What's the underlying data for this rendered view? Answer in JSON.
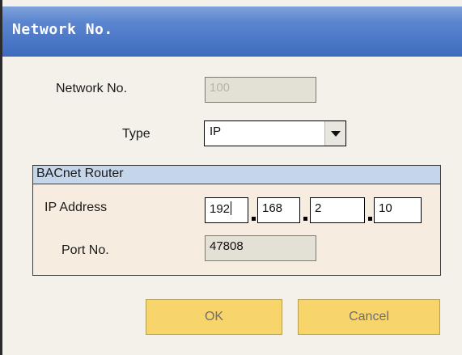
{
  "window": {
    "title": "Network No."
  },
  "form": {
    "network_no_label": "Network No.",
    "network_no_value": "100",
    "type_label": "Type",
    "type_value": "IP"
  },
  "router_group": {
    "title": "BACnet Router",
    "ip_label": "IP Address",
    "ip_octets": [
      "192",
      "168",
      "2",
      "10"
    ],
    "port_label": "Port No.",
    "port_value": "47808"
  },
  "buttons": {
    "ok_label": "OK",
    "cancel_label": "Cancel"
  },
  "colors": {
    "title_bar": "#4a76c6",
    "group_header": "#c6d6ea",
    "group_body": "#f6ede0",
    "button": "#f7d56a"
  },
  "icons": {
    "select_arrow": "chevron-down-icon"
  }
}
